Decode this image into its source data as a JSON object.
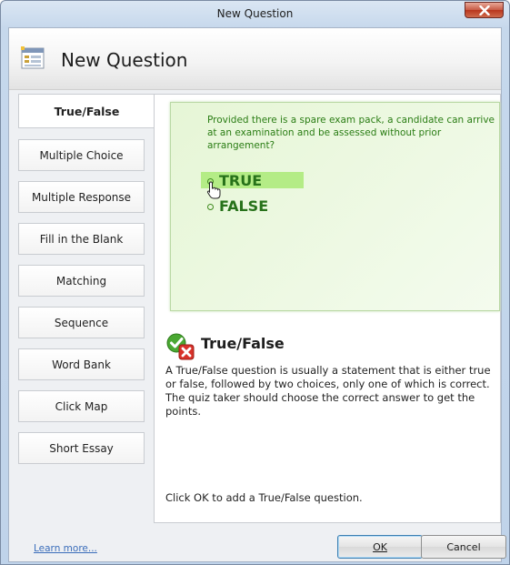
{
  "window": {
    "title": "New Question"
  },
  "header": {
    "title": "New Question",
    "icon": "form-icon"
  },
  "tabs": [
    {
      "label": "True/False",
      "active": true
    },
    {
      "label": "Multiple Choice"
    },
    {
      "label": "Multiple Response"
    },
    {
      "label": "Fill in the Blank"
    },
    {
      "label": "Matching"
    },
    {
      "label": "Sequence"
    },
    {
      "label": "Word Bank"
    },
    {
      "label": "Click Map"
    },
    {
      "label": "Short Essay"
    }
  ],
  "preview": {
    "question": "Provided there is a spare exam pack, a candidate can arrive at an examination and be assessed without prior arrangement?",
    "options": [
      "TRUE",
      "FALSE"
    ]
  },
  "info": {
    "icon": "check-cross-icon",
    "title": "True/False",
    "description": "A True/False question is usually a statement that is either true or false, followed by two choices, only one of which is correct. The quiz taker should choose the correct answer to get the points.",
    "footer": "Click OK to add a True/False question."
  },
  "footer": {
    "learn_more": "Learn more...",
    "ok_label": "OK",
    "cancel_label": "Cancel"
  },
  "colors": {
    "accent_green": "#2a7d14",
    "preview_bg": "#e6f6d6",
    "link": "#3a6dba"
  }
}
